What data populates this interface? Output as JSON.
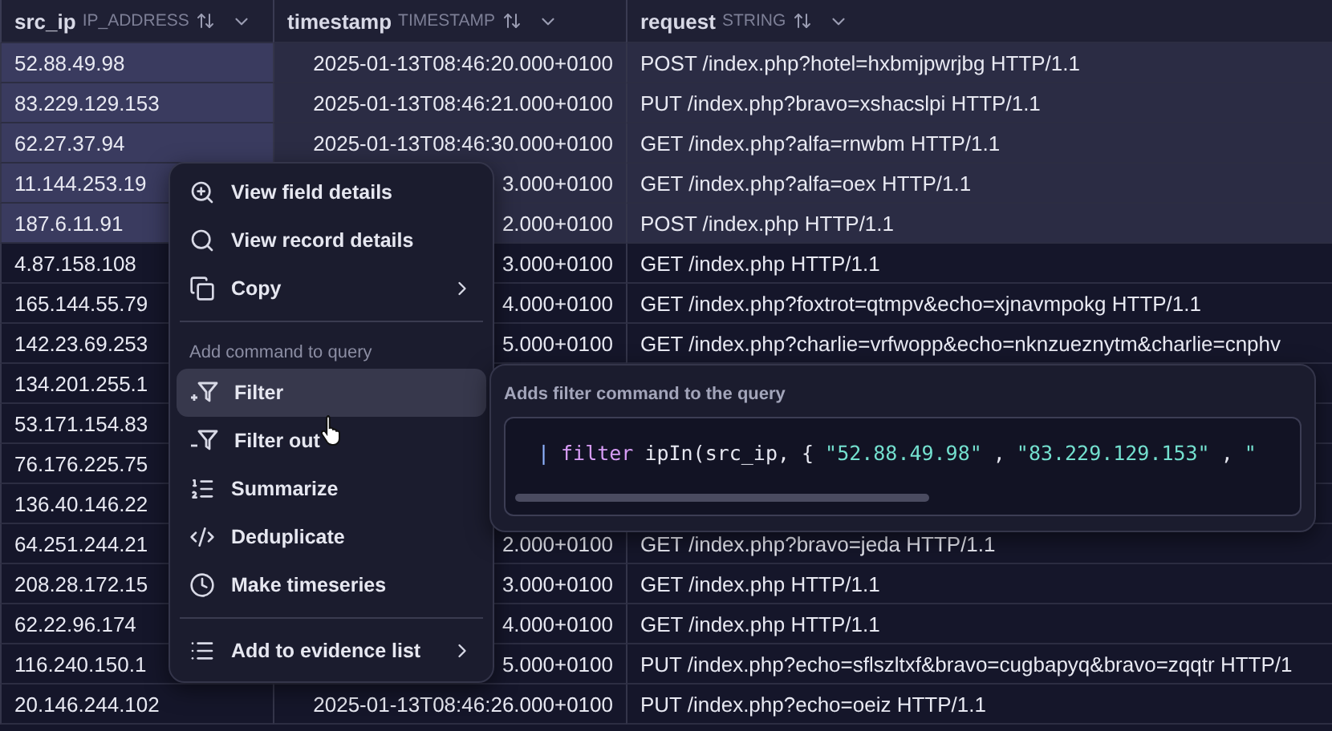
{
  "table": {
    "columns": [
      {
        "name": "src_ip",
        "type": "IP_ADDRESS"
      },
      {
        "name": "timestamp",
        "type": "TIMESTAMP"
      },
      {
        "name": "request",
        "type": "STRING"
      }
    ],
    "rows": [
      {
        "selected": true,
        "src_ip": "52.88.49.98",
        "timestamp": "2025-01-13T08:46:20.000+0100",
        "request": "POST /index.php?hotel=hxbmjpwrjbg HTTP/1.1"
      },
      {
        "selected": true,
        "src_ip": "83.229.129.153",
        "timestamp": "2025-01-13T08:46:21.000+0100",
        "request": "PUT /index.php?bravo=xshacslpi HTTP/1.1"
      },
      {
        "selected": true,
        "src_ip": "62.27.37.94",
        "timestamp": "2025-01-13T08:46:30.000+0100",
        "request": "GET /index.php?alfa=rnwbm HTTP/1.1"
      },
      {
        "selected": true,
        "src_ip": "11.144.253.19",
        "timestamp": "3.000+0100",
        "request": "GET /index.php?alfa=oex HTTP/1.1"
      },
      {
        "selected": true,
        "src_ip": "187.6.11.91",
        "timestamp": "2.000+0100",
        "request": "POST /index.php HTTP/1.1"
      },
      {
        "selected": false,
        "src_ip": "4.87.158.108",
        "timestamp": "3.000+0100",
        "request": "GET /index.php HTTP/1.1"
      },
      {
        "selected": false,
        "src_ip": "165.144.55.79",
        "timestamp": "4.000+0100",
        "request": "GET /index.php?foxtrot=qtmpv&echo=xjnavmpokg HTTP/1.1"
      },
      {
        "selected": false,
        "src_ip": "142.23.69.253",
        "timestamp": "5.000+0100",
        "request": "GET /index.php?charlie=vrfwopp&echo=nknzueznytm&charlie=cnphv"
      },
      {
        "selected": false,
        "src_ip": "134.201.255.1"
      },
      {
        "selected": false,
        "src_ip": "53.171.154.83"
      },
      {
        "selected": false,
        "src_ip": "76.176.225.75"
      },
      {
        "selected": false,
        "src_ip": "136.40.146.22"
      },
      {
        "selected": false,
        "src_ip": "64.251.244.21",
        "timestamp": "2.000+0100",
        "request": "GET /index.php?bravo=jeda HTTP/1.1"
      },
      {
        "selected": false,
        "src_ip": "208.28.172.15",
        "timestamp": "3.000+0100",
        "request": "GET /index.php HTTP/1.1"
      },
      {
        "selected": false,
        "src_ip": "62.22.96.174",
        "timestamp": "4.000+0100",
        "request": "GET /index.php HTTP/1.1"
      },
      {
        "selected": false,
        "src_ip": "116.240.150.1",
        "timestamp": "5.000+0100",
        "request": "PUT /index.php?echo=sflszltxf&bravo=cugbapyq&bravo=zqqtr HTTP/1"
      },
      {
        "selected": false,
        "src_ip": "20.146.244.102",
        "timestamp": "2025-01-13T08:46:26.000+0100",
        "request": "PUT /index.php?echo=oeiz HTTP/1.1"
      }
    ]
  },
  "context_menu": {
    "items": [
      {
        "kind": "item",
        "label": "View field details",
        "selected": false,
        "submenu": false
      },
      {
        "kind": "item",
        "label": "View record details",
        "selected": false,
        "submenu": false
      },
      {
        "kind": "item",
        "label": "Copy",
        "selected": false,
        "submenu": true
      },
      {
        "kind": "divider"
      },
      {
        "kind": "section",
        "label": "Add command to query"
      },
      {
        "kind": "item",
        "label": "Filter",
        "selected": true,
        "submenu": false
      },
      {
        "kind": "item",
        "label": "Filter out",
        "selected": false,
        "submenu": false
      },
      {
        "kind": "item",
        "label": "Summarize",
        "selected": false,
        "submenu": false
      },
      {
        "kind": "item",
        "label": "Deduplicate",
        "selected": false,
        "submenu": false
      },
      {
        "kind": "item",
        "label": "Make timeseries",
        "selected": false,
        "submenu": false
      },
      {
        "kind": "divider"
      },
      {
        "kind": "item",
        "label": "Add to evidence list",
        "selected": false,
        "submenu": true
      }
    ]
  },
  "tooltip": {
    "title": "Adds filter command to the query",
    "code": [
      {
        "kind": "pipe",
        "text": "|"
      },
      {
        "kind": "keyword",
        "text": "filter"
      },
      {
        "kind": "plain",
        "text": "ipIn(src_ip, {"
      },
      {
        "kind": "string",
        "text": "\"52.88.49.98\""
      },
      {
        "kind": "plain",
        "text": ","
      },
      {
        "kind": "string",
        "text": "\"83.229.129.153\""
      },
      {
        "kind": "plain",
        "text": ","
      },
      {
        "kind": "string",
        "text": "\""
      }
    ]
  }
}
